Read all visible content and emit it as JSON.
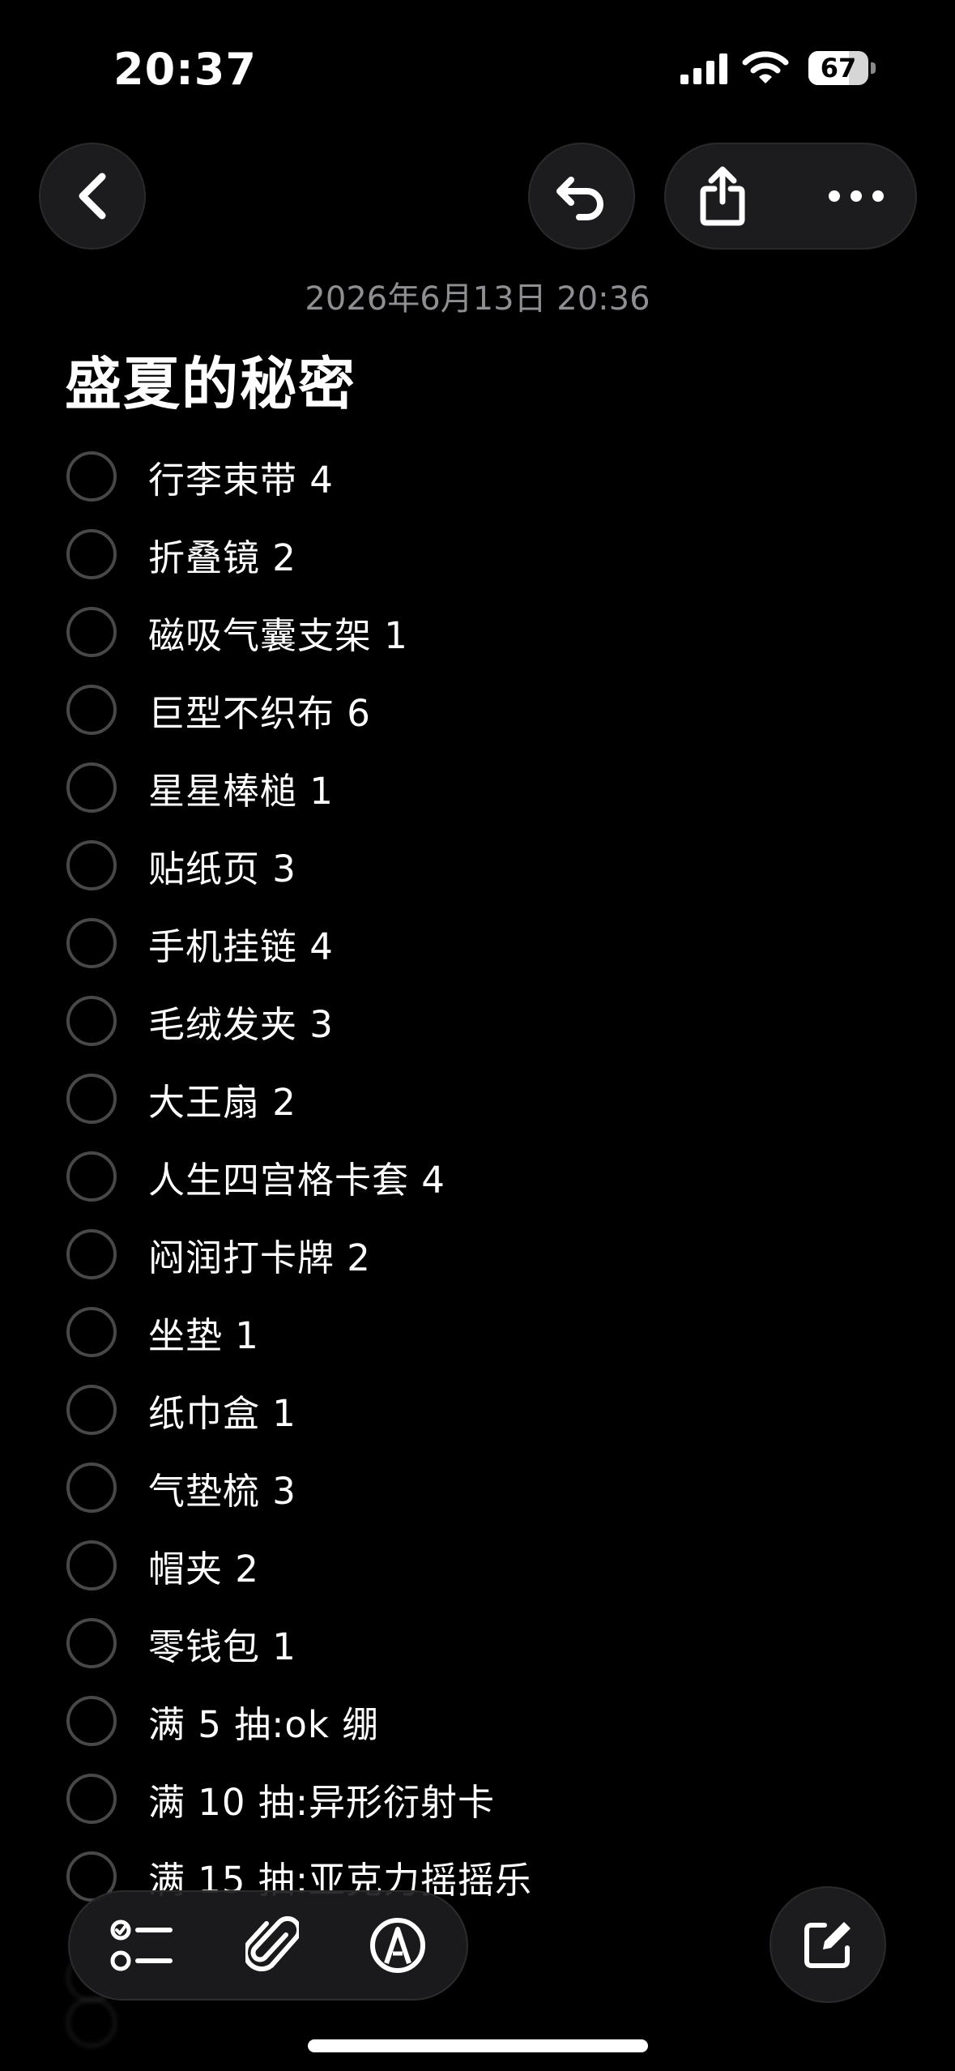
{
  "status_bar": {
    "time": "20:37",
    "battery_level": "67",
    "battery_fraction": 0.67
  },
  "toolbar": {
    "back_icon": "chevron-left-icon",
    "undo_icon": "undo-icon",
    "share_icon": "share-icon",
    "more_icon": "ellipsis-icon"
  },
  "note": {
    "date": "2026年6月13日 20:36",
    "title": "盛夏的秘密",
    "items": [
      {
        "label": "行李束带 4",
        "checked": false
      },
      {
        "label": "折叠镜 2",
        "checked": false
      },
      {
        "label": "磁吸气囊支架 1",
        "checked": false
      },
      {
        "label": "巨型不织布 6",
        "checked": false
      },
      {
        "label": "星星棒槌 1",
        "checked": false
      },
      {
        "label": "贴纸页 3",
        "checked": false
      },
      {
        "label": "手机挂链 4",
        "checked": false
      },
      {
        "label": "毛绒发夹 3",
        "checked": false
      },
      {
        "label": "大王扇 2",
        "checked": false
      },
      {
        "label": "人生四宫格卡套 4",
        "checked": false
      },
      {
        "label": "闷润打卡牌 2",
        "checked": false
      },
      {
        "label": "坐垫 1",
        "checked": false
      },
      {
        "label": "纸巾盒 1",
        "checked": false
      },
      {
        "label": "气垫梳 3",
        "checked": false
      },
      {
        "label": "帽夹 2",
        "checked": false
      },
      {
        "label": "零钱包 1",
        "checked": false
      },
      {
        "label": "满 5 抽:ok 绷",
        "checked": false
      },
      {
        "label": "满 10 抽:异形衍射卡",
        "checked": false
      },
      {
        "label": "满 15 抽:亚克力摇摇乐",
        "checked": false
      }
    ]
  },
  "bottom_bar": {
    "checklist_icon": "checklist-icon",
    "attach_icon": "paperclip-icon",
    "markup_icon": "markup-pen-icon",
    "compose_icon": "compose-icon"
  },
  "colors": {
    "background": "#000000",
    "text": "#ffffff",
    "secondary_text": "#8e8e93",
    "button_bg": "#1c1c1e",
    "circle_stroke": "#48484a"
  }
}
